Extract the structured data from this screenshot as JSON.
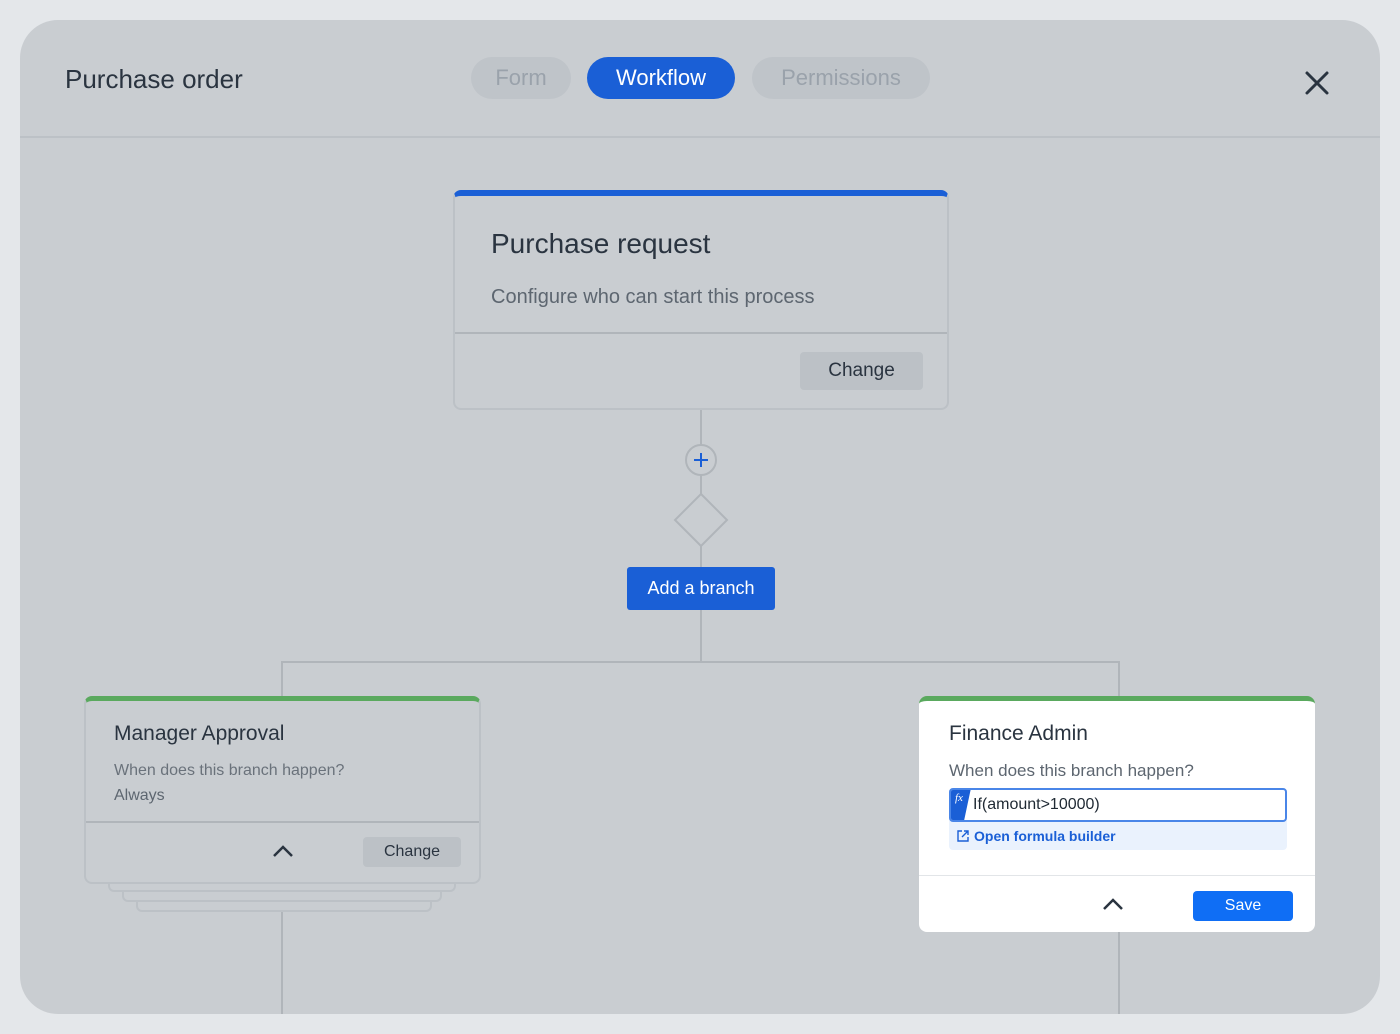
{
  "header": {
    "title": "Purchase order",
    "tabs": [
      {
        "label": "Form",
        "active": false
      },
      {
        "label": "Workflow",
        "active": true
      },
      {
        "label": "Permissions",
        "active": false
      }
    ]
  },
  "start_card": {
    "title": "Purchase request",
    "subtitle": "Configure who can start this process",
    "change_label": "Change"
  },
  "add_branch_label": "Add a branch",
  "branches": [
    {
      "title": "Manager Approval",
      "question": "When does this branch happen?",
      "condition": "Always",
      "change_label": "Change"
    },
    {
      "title": "Finance Admin",
      "question": "When does this branch happen?",
      "formula": "If(amount>10000)",
      "formula_icon": "fx",
      "formula_link": "Open formula builder",
      "save_label": "Save"
    }
  ],
  "colors": {
    "accent": "#1a5fd6",
    "branch": "#5aa95e",
    "save": "#0f6ef5"
  }
}
